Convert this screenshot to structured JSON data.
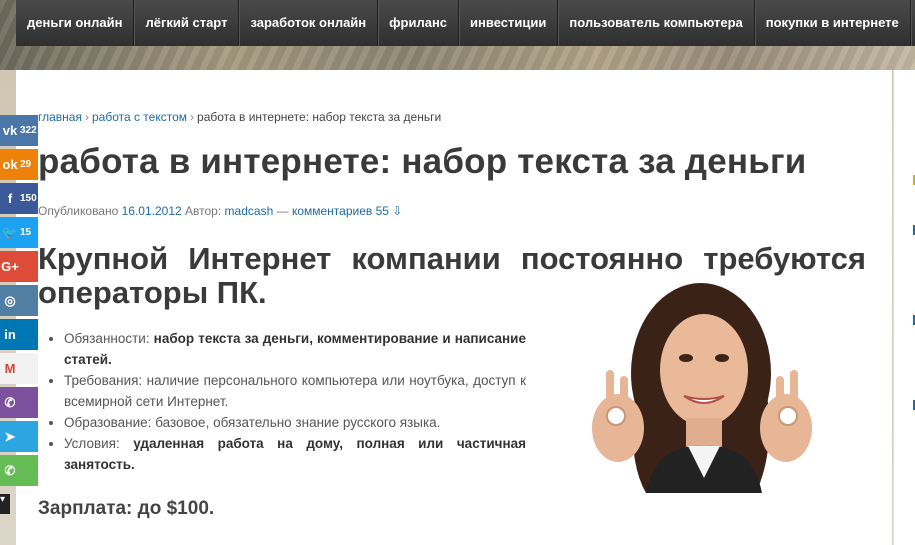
{
  "nav": {
    "items": [
      {
        "label": "деньги онлайн"
      },
      {
        "label": "лёгкий старт"
      },
      {
        "label": "заработок онлайн"
      },
      {
        "label": "фриланс"
      },
      {
        "label": "инвестиции"
      },
      {
        "label": "пользователь компьютера"
      },
      {
        "label": "покупки в интернете"
      }
    ]
  },
  "breadcrumb": {
    "home": "главная",
    "section": "работа с текстом",
    "current": "работа в интернете: набор текста за деньги"
  },
  "article": {
    "title": "работа в интернете: набор текста за деньги",
    "meta_prefix": "Опубликовано",
    "date": "16.01.2012",
    "author_prefix": "Автор:",
    "author": "madcash",
    "comments_sep": "—",
    "comments": "комментариев 55 ⇩",
    "heading": "Крупной Интернет компании постоянно требуются операторы ПК.",
    "list": [
      {
        "label": "Обязанности:",
        "value": "набор текста за деньги, комментирование и написание статей.",
        "bold": true
      },
      {
        "label": "Требования:",
        "value": "наличие персонального компьютера или ноутбука, доступ к всемирной сети Интернет.",
        "bold": false
      },
      {
        "label": "Образование:",
        "value": "базовое, обязательно знание русского языка.",
        "bold": false
      },
      {
        "label": "Условия:",
        "value": "удаленная работа на дому, полная или частичная занятость.",
        "bold": true
      }
    ],
    "salary": "Зарплата: до $100."
  },
  "share": [
    {
      "icon": "vk-icon",
      "glyph": "vk",
      "count": "322",
      "color": "#4a76a8"
    },
    {
      "icon": "odnoklassniki-icon",
      "glyph": "ok",
      "count": "29",
      "color": "#ee8208"
    },
    {
      "icon": "facebook-icon",
      "glyph": "f",
      "count": "150",
      "color": "#3b5998"
    },
    {
      "icon": "twitter-icon",
      "glyph": "🐦",
      "count": "15",
      "color": "#1da1f2"
    },
    {
      "icon": "google-plus-icon",
      "glyph": "G+",
      "count": "",
      "color": "#dd4b39"
    },
    {
      "icon": "instagram-icon",
      "glyph": "◎",
      "count": "",
      "color": "#517fa4"
    },
    {
      "icon": "linkedin-icon",
      "glyph": "in",
      "count": "",
      "color": "#0077b5"
    },
    {
      "icon": "gmail-icon",
      "glyph": "M",
      "count": "",
      "color": "#f2f2f2"
    },
    {
      "icon": "viber-icon",
      "glyph": "✆",
      "count": "",
      "color": "#7b519d"
    },
    {
      "icon": "telegram-icon",
      "glyph": "➤",
      "count": "",
      "color": "#2ca5e0"
    },
    {
      "icon": "whatsapp-icon",
      "glyph": "✆",
      "count": "",
      "color": "#65bc54"
    }
  ]
}
